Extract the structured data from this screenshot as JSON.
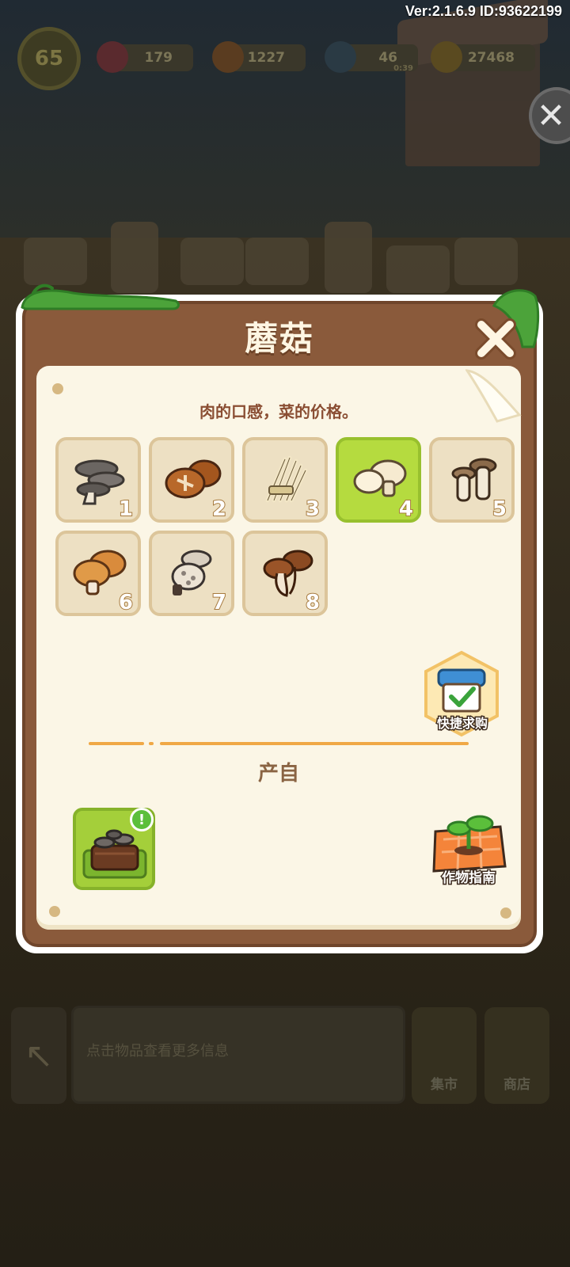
{
  "hud": {
    "version": "Ver:2.1.6.9 ID:93622199",
    "level": "65",
    "gems": "179",
    "carrots": "1227",
    "energy": "46",
    "energy_timer": "0:39",
    "coins": "27468"
  },
  "background": {
    "hint_text": "点击物品查看更多信息",
    "market_label": "集市",
    "shop_label": "商店"
  },
  "modal": {
    "title": "蘑菇",
    "description": "肉的口感，菜的价格。",
    "selected_index": 4,
    "items": [
      {
        "num": "1",
        "icon": "oyster-mushroom-icon"
      },
      {
        "num": "2",
        "icon": "shiitake-mushroom-icon"
      },
      {
        "num": "3",
        "icon": "enoki-mushroom-icon"
      },
      {
        "num": "4",
        "icon": "button-mushroom-icon"
      },
      {
        "num": "5",
        "icon": "king-oyster-mushroom-icon"
      },
      {
        "num": "6",
        "icon": "orange-mushroom-icon"
      },
      {
        "num": "7",
        "icon": "spotted-mushroom-icon"
      },
      {
        "num": "8",
        "icon": "brown-mushroom-icon"
      }
    ],
    "quick_buy_label": "快捷求购",
    "source_title": "产自",
    "source_alert": "!",
    "crop_guide_label": "作物指南"
  },
  "colors": {
    "panel_brown": "#8a5a3b",
    "paper": "#fbf6e6",
    "selected_green": "#b5db3f",
    "accent_orange": "#f0a845"
  }
}
